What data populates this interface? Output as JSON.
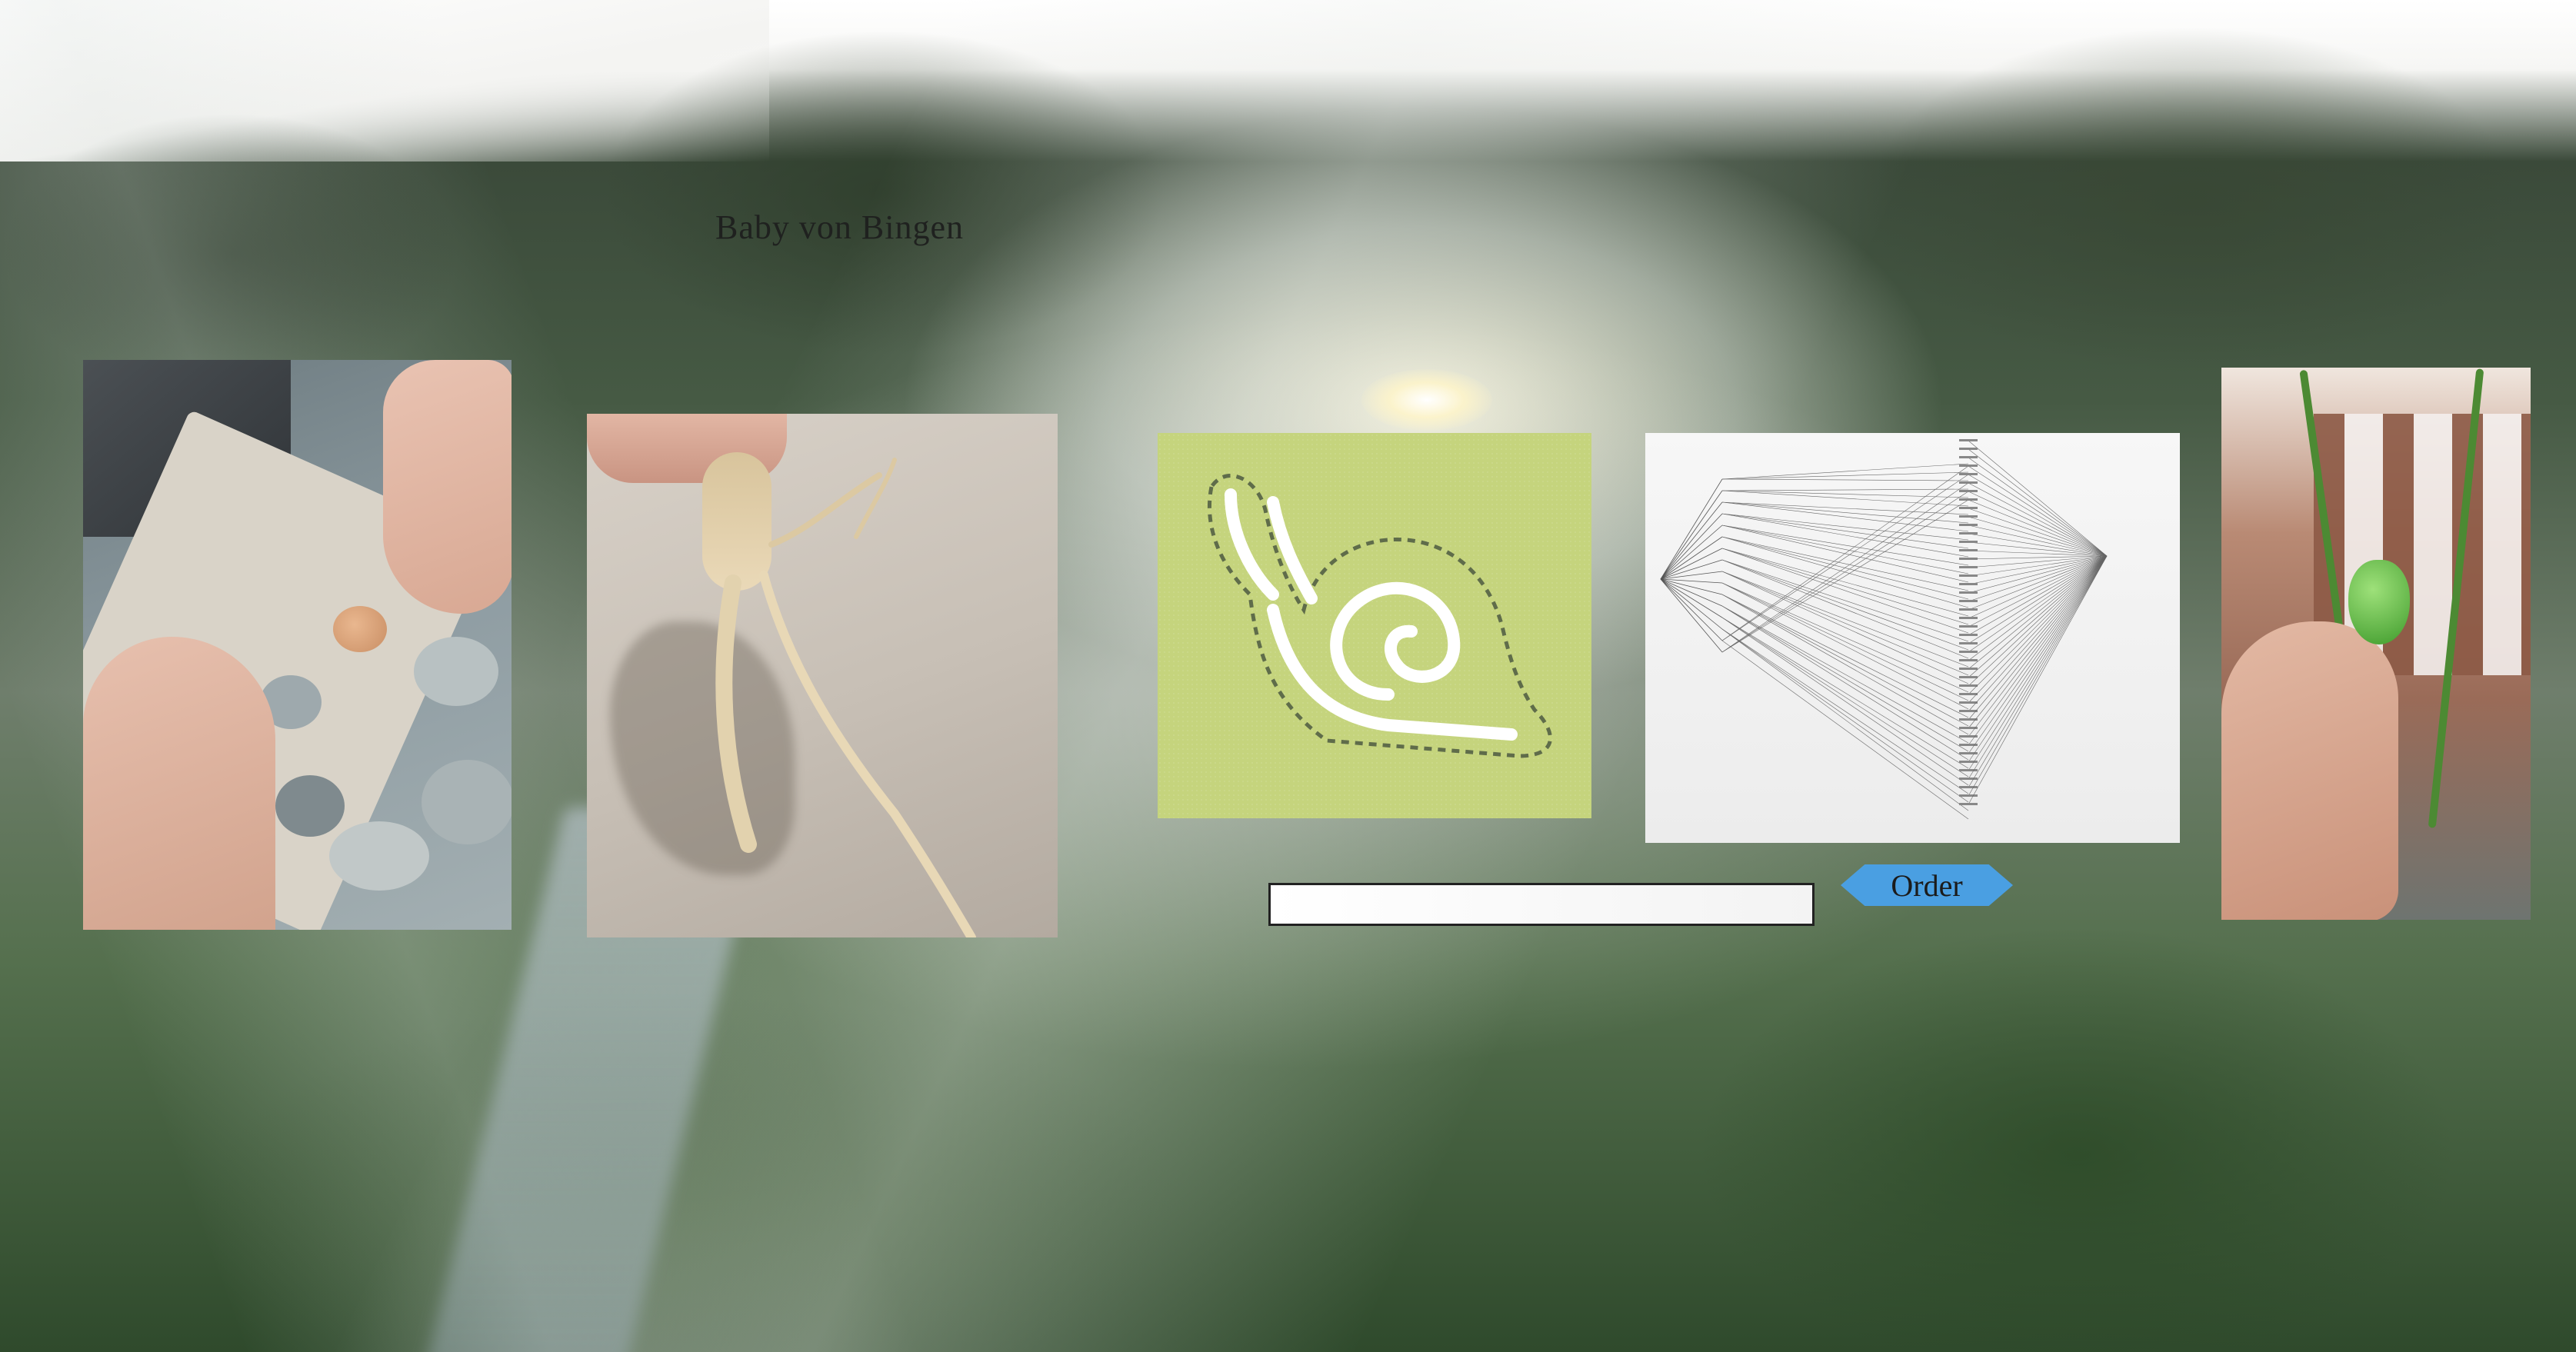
{
  "site": {
    "title": "Baby von Bingen"
  },
  "gallery": {
    "images": [
      {
        "icon": "eggs-photo"
      },
      {
        "icon": "root-photo"
      },
      {
        "icon": "snail-patch-photo"
      },
      {
        "icon": "line-diagram-photo"
      },
      {
        "icon": "balcony-pepper-photo"
      }
    ]
  },
  "order_form": {
    "input_value": "",
    "input_placeholder": "",
    "button_label": "Order"
  },
  "colors": {
    "button": "#4a9fe2",
    "title": "#1f211f"
  }
}
